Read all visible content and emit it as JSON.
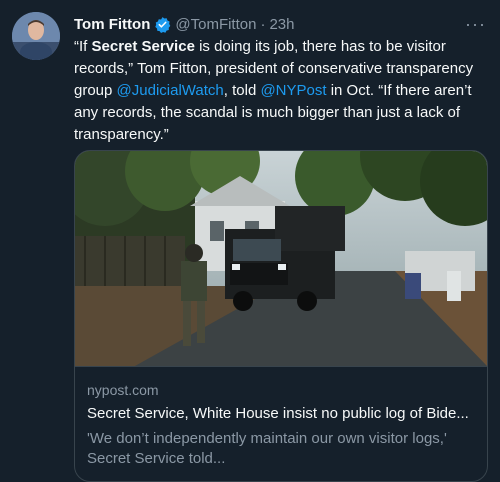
{
  "tweet": {
    "author_name": "Tom Fitton",
    "author_handle": "@TomFitton",
    "separator": "·",
    "time": "23h",
    "more_label": "···",
    "text": {
      "q_open": "“If ",
      "bold_1": "Secret Service",
      "part_2": " is doing its job, there has to be visitor records,” Tom Fitton, president of conservative transparency group ",
      "mention_1": "@JudicialWatch",
      "part_3": ", told ",
      "mention_2": "@NYPost",
      "part_4": " in Oct. “If there aren’t any records, the scandal is much bigger than just a lack of transparency.”"
    },
    "card": {
      "domain": "nypost.com",
      "title": "Secret Service, White House insist no public log of Bide...",
      "description": "'We don’t independently maintain our own visitor logs,' Secret Service told..."
    },
    "colors": {
      "background": "#15202b",
      "accent": "#1d9bf0",
      "secondary_text": "#8b98a5"
    }
  }
}
